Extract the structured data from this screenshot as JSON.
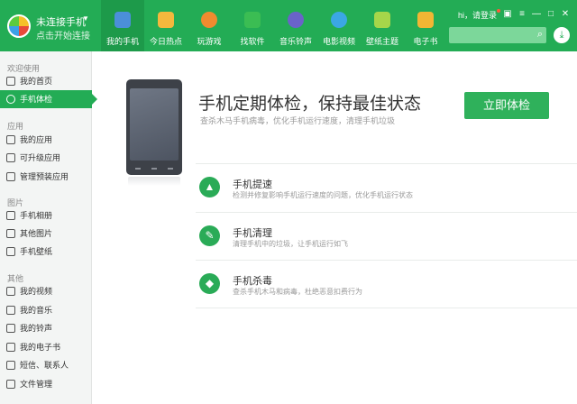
{
  "brand": {
    "title": "未连接手机",
    "subtitle": "点击开始连接",
    "caret": "▼"
  },
  "nav": [
    {
      "label": "我的手机",
      "color": "#4b8fd9",
      "icon": "phone-icon"
    },
    {
      "label": "今日热点",
      "color": "#f4b83d",
      "icon": "star-icon"
    },
    {
      "label": "玩游戏",
      "color": "#f08b2f",
      "icon": "gamepad-icon"
    },
    {
      "label": "找软件",
      "color": "#3bbd53",
      "icon": "apps-icon"
    },
    {
      "label": "音乐铃声",
      "color": "#6a63c9",
      "icon": "music-icon"
    },
    {
      "label": "电影视频",
      "color": "#3ba7e4",
      "icon": "play-icon"
    },
    {
      "label": "壁纸主题",
      "color": "#a6d64a",
      "icon": "wallpaper-icon"
    },
    {
      "label": "电子书",
      "color": "#f2b634",
      "icon": "book-icon"
    }
  ],
  "user": {
    "greeting": "hi，请登录"
  },
  "window": {
    "skin": "▣",
    "menu": "≡",
    "minimize": "—",
    "maximize": "□",
    "close": "✕"
  },
  "search": {
    "placeholder": "",
    "icon": "⌕"
  },
  "download": {
    "icon": "⤓"
  },
  "sidebar": {
    "sections": [
      {
        "title": "欢迎使用",
        "items": [
          "我的首页",
          "手机体检"
        ]
      },
      {
        "title": "应用",
        "items": [
          "我的应用",
          "可升级应用",
          "管理预装应用"
        ]
      },
      {
        "title": "图片",
        "items": [
          "手机相册",
          "其他图片",
          "手机壁纸"
        ]
      },
      {
        "title": "其他",
        "items": [
          "我的视频",
          "我的音乐",
          "我的铃声",
          "我的电子书",
          "短信、联系人",
          "文件管理"
        ]
      }
    ],
    "active": "手机体检"
  },
  "main": {
    "headline": "手机定期体检，保持最佳状态",
    "subline": "查杀木马手机病毒，优化手机运行速度，清理手机垃圾",
    "button": "立即体检",
    "features": [
      {
        "title": "手机提速",
        "desc": "检测并修复影响手机运行速度的问题，优化手机运行状态",
        "icon": "rocket-icon",
        "glyph": "▲"
      },
      {
        "title": "手机清理",
        "desc": "清理手机中的垃圾，让手机运行如飞",
        "icon": "broom-icon",
        "glyph": "✎"
      },
      {
        "title": "手机杀毒",
        "desc": "查杀手机木马和病毒，杜绝恶意扣费行为",
        "icon": "shield-icon",
        "glyph": "◆"
      }
    ]
  }
}
